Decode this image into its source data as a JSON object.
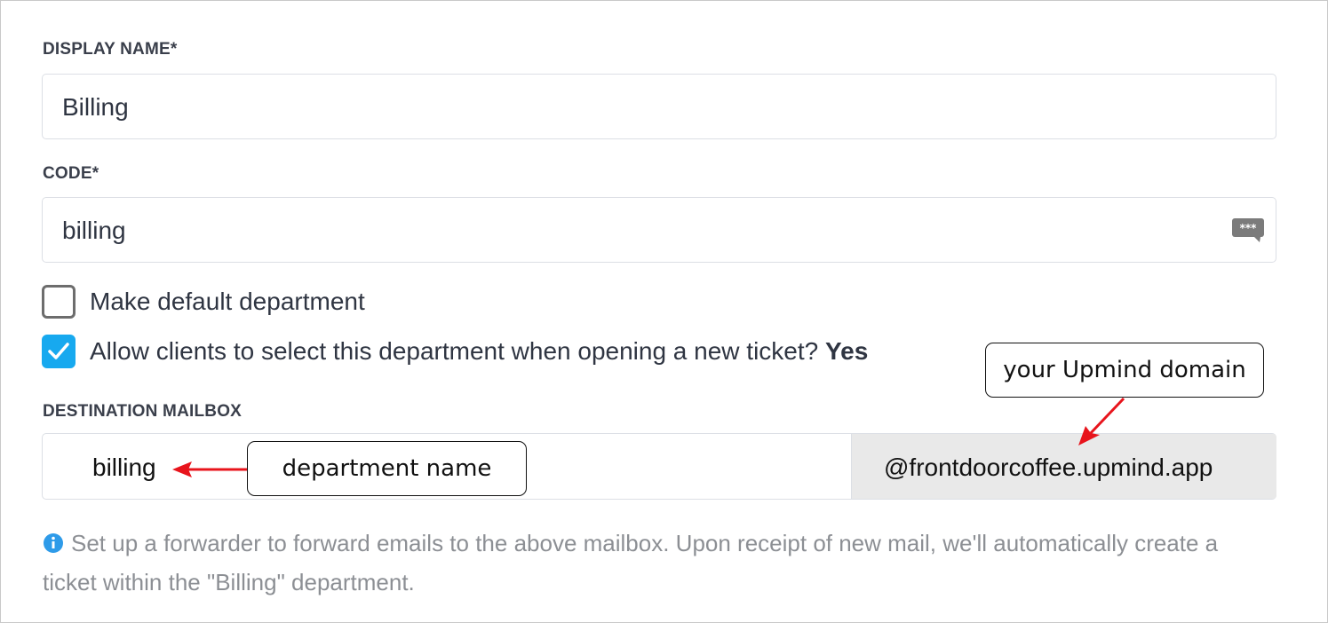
{
  "form": {
    "display_name": {
      "label": "DISPLAY NAME*",
      "value": "Billing"
    },
    "code": {
      "label": "CODE*",
      "value": "billing",
      "icon": "password-manager-icon"
    },
    "make_default": {
      "label": "Make default department",
      "checked": false
    },
    "allow_clients": {
      "label": "Allow clients to select this department when opening a new ticket?",
      "status": "Yes",
      "checked": true
    },
    "destination_mailbox": {
      "label": "DESTINATION MAILBOX",
      "local_part": "billing",
      "domain": "@frontdoorcoffee.upmind.app"
    },
    "help_text": "Set up a forwarder to forward emails to the above mailbox. Upon receipt of new mail, we'll automatically create a ticket within the \"Billing\" department."
  },
  "annotations": {
    "department_name": "department name",
    "upmind_domain": "your Upmind domain"
  },
  "colors": {
    "checkbox_checked": "#17a9ef",
    "arrow": "#e8141c",
    "info_icon": "#2e9be9"
  }
}
